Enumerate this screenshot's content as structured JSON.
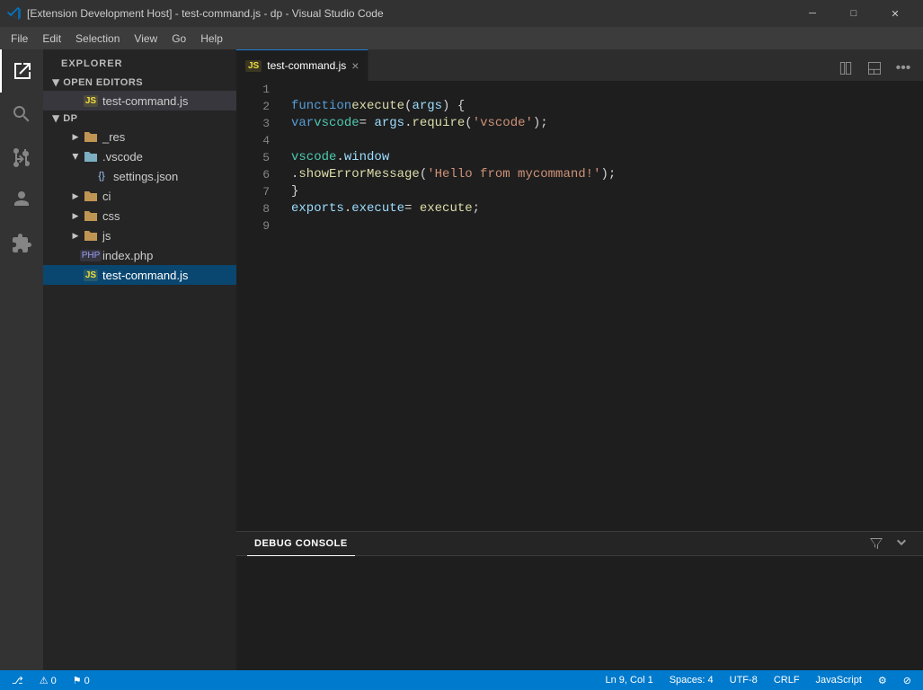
{
  "titleBar": {
    "title": "[Extension Development Host] - test-command.js - dp - Visual Studio Code",
    "icon": "VS",
    "minimizeLabel": "─",
    "maximizeLabel": "□",
    "closeLabel": "✕"
  },
  "menuBar": {
    "items": [
      "File",
      "Edit",
      "Selection",
      "View",
      "Go",
      "Help"
    ]
  },
  "activityBar": {
    "icons": [
      {
        "name": "explorer-icon",
        "symbol": "⎘",
        "active": true
      },
      {
        "name": "search-icon",
        "symbol": "🔍"
      },
      {
        "name": "source-control-icon",
        "symbol": "⑂"
      },
      {
        "name": "debug-icon",
        "symbol": "▷"
      },
      {
        "name": "extensions-icon",
        "symbol": "⊞"
      }
    ]
  },
  "sidebar": {
    "title": "EXPLORER",
    "openEditors": {
      "label": "OPEN EDITORS",
      "files": [
        {
          "name": "test-command.js",
          "type": "js"
        }
      ]
    },
    "tree": {
      "rootLabel": "DP",
      "items": [
        {
          "id": "res",
          "label": "_res",
          "type": "folder",
          "indent": 2,
          "arrow": true
        },
        {
          "id": "vscode",
          "label": ".vscode",
          "type": "folder-blue-open",
          "indent": 2,
          "arrow": true,
          "open": true
        },
        {
          "id": "settings",
          "label": "settings.json",
          "type": "json",
          "indent": 3
        },
        {
          "id": "ci",
          "label": "ci",
          "type": "folder",
          "indent": 2,
          "arrow": true
        },
        {
          "id": "css",
          "label": "css",
          "type": "folder",
          "indent": 2,
          "arrow": true
        },
        {
          "id": "js",
          "label": "js",
          "type": "folder",
          "indent": 2,
          "arrow": true
        },
        {
          "id": "index",
          "label": "index.php",
          "type": "php",
          "indent": 2
        },
        {
          "id": "testcmd",
          "label": "test-command.js",
          "type": "js",
          "indent": 2,
          "active": true
        }
      ]
    }
  },
  "editor": {
    "tab": {
      "label": "test-command.js",
      "type": "js"
    },
    "lines": [
      {
        "num": 1,
        "tokens": []
      },
      {
        "num": 2,
        "text": "function execute(args) {"
      },
      {
        "num": 3,
        "text": "    var vscode = args.require('vscode');"
      },
      {
        "num": 4,
        "tokens": []
      },
      {
        "num": 5,
        "text": "    vscode.window"
      },
      {
        "num": 6,
        "text": "            .showErrorMessage('Hello from mycommand!');"
      },
      {
        "num": 7,
        "text": "}"
      },
      {
        "num": 8,
        "text": "exports.execute = execute;"
      },
      {
        "num": 9,
        "tokens": []
      }
    ]
  },
  "panel": {
    "tabs": [
      "DEBUG CONSOLE"
    ],
    "activeTab": "DEBUG CONSOLE"
  },
  "statusBar": {
    "left": [
      {
        "label": "⎇",
        "text": ""
      },
      {
        "label": "⚠ 0"
      },
      {
        "label": "⚑ 0"
      }
    ],
    "right": [
      {
        "label": "Ln 9, Col 1"
      },
      {
        "label": "Spaces: 4"
      },
      {
        "label": "UTF-8"
      },
      {
        "label": "CRLF"
      },
      {
        "label": "JavaScript"
      },
      {
        "label": "⚙"
      },
      {
        "label": "⊘"
      }
    ]
  }
}
